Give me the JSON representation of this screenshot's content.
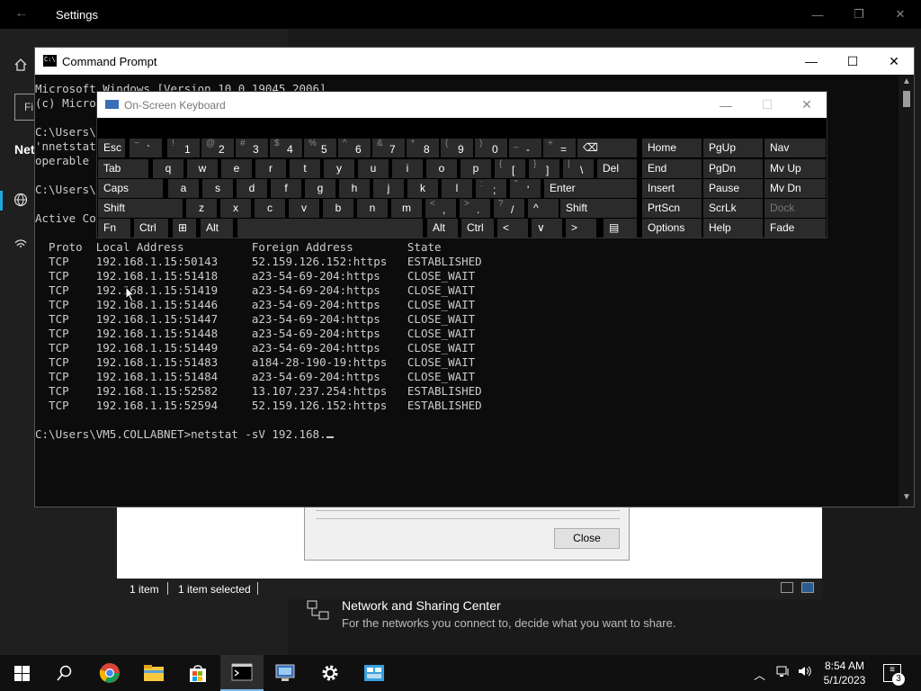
{
  "settings": {
    "title": "Settings",
    "search_placeholder": "Fi",
    "nav_label": "Net",
    "minimize": "—",
    "maximize": "❐",
    "close": "✕"
  },
  "control_panel": {
    "close_label": "Close",
    "status_item_count": "1 item",
    "status_selected": "1 item selected",
    "nsc_title": "Network and Sharing Center",
    "nsc_desc": "For the networks you connect to, decide what you want to share."
  },
  "cmd": {
    "title": "Command Prompt",
    "lines": [
      "Microsoft Windows [Version 10.0.19045.2006]",
      "(c) Micro",
      "",
      "C:\\Users\\",
      "'nnetstat",
      "operable",
      "",
      "C:\\Users\\",
      "",
      "Active Co",
      "",
      "  Proto  Local Address          Foreign Address        State",
      "  TCP    192.168.1.15:50143     52.159.126.152:https   ESTABLISHED",
      "  TCP    192.168.1.15:51418     a23-54-69-204:https    CLOSE_WAIT",
      "  TCP    192.168.1.15:51419     a23-54-69-204:https    CLOSE_WAIT",
      "  TCP    192.168.1.15:51446     a23-54-69-204:https    CLOSE_WAIT",
      "  TCP    192.168.1.15:51447     a23-54-69-204:https    CLOSE_WAIT",
      "  TCP    192.168.1.15:51448     a23-54-69-204:https    CLOSE_WAIT",
      "  TCP    192.168.1.15:51449     a23-54-69-204:https    CLOSE_WAIT",
      "  TCP    192.168.1.15:51483     a184-28-190-19:https   CLOSE_WAIT",
      "  TCP    192.168.1.15:51484     a23-54-69-204:https    CLOSE_WAIT",
      "  TCP    192.168.1.15:52582     13.107.237.254:https   ESTABLISHED",
      "  TCP    192.168.1.15:52594     52.159.126.152:https   ESTABLISHED",
      "",
      "C:\\Users\\VM5.COLLABNET>netstat -sV 192.168."
    ]
  },
  "osk": {
    "title": "On-Screen Keyboard",
    "row1": [
      {
        "t": "Esc"
      },
      {
        "s": "~",
        "b": "`"
      },
      {
        "s": "!",
        "b": "1"
      },
      {
        "s": "@",
        "b": "2"
      },
      {
        "s": "#",
        "b": "3"
      },
      {
        "s": "$",
        "b": "4"
      },
      {
        "s": "%",
        "b": "5"
      },
      {
        "s": "^",
        "b": "6"
      },
      {
        "s": "&",
        "b": "7"
      },
      {
        "s": "*",
        "b": "8"
      },
      {
        "s": "(",
        "b": "9"
      },
      {
        "s": ")",
        "b": "0"
      },
      {
        "s": "_",
        "b": "-"
      },
      {
        "s": "+",
        "b": "="
      },
      {
        "t": "⌫"
      }
    ],
    "row2": [
      {
        "t": "Tab"
      },
      {
        "t": "q"
      },
      {
        "t": "w"
      },
      {
        "t": "e"
      },
      {
        "t": "r"
      },
      {
        "t": "t"
      },
      {
        "t": "y"
      },
      {
        "t": "u"
      },
      {
        "t": "i"
      },
      {
        "t": "o"
      },
      {
        "t": "p"
      },
      {
        "s": "{",
        "b": "["
      },
      {
        "s": "}",
        "b": "]"
      },
      {
        "s": "|",
        "b": "\\"
      },
      {
        "t": "Del"
      }
    ],
    "row3": [
      {
        "t": "Caps"
      },
      {
        "t": "a"
      },
      {
        "t": "s"
      },
      {
        "t": "d"
      },
      {
        "t": "f"
      },
      {
        "t": "g"
      },
      {
        "t": "h"
      },
      {
        "t": "j"
      },
      {
        "t": "k"
      },
      {
        "t": "l"
      },
      {
        "s": ":",
        "b": ";"
      },
      {
        "s": "\"",
        "b": "'"
      },
      {
        "t": "Enter"
      }
    ],
    "row4": [
      {
        "t": "Shift"
      },
      {
        "t": "z"
      },
      {
        "t": "x"
      },
      {
        "t": "c"
      },
      {
        "t": "v"
      },
      {
        "t": "b"
      },
      {
        "t": "n"
      },
      {
        "t": "m"
      },
      {
        "s": "<",
        "b": ","
      },
      {
        "s": ">",
        "b": "."
      },
      {
        "s": "?",
        "b": "/"
      },
      {
        "t": "^"
      },
      {
        "t": "Shift"
      }
    ],
    "row5": [
      {
        "t": "Fn"
      },
      {
        "t": "Ctrl"
      },
      {
        "t": "⊞"
      },
      {
        "t": "Alt"
      },
      {
        "t": ""
      },
      {
        "t": "Alt"
      },
      {
        "t": "Ctrl"
      },
      {
        "t": "<"
      },
      {
        "t": "∨"
      },
      {
        "t": ">"
      },
      {
        "t": "▤"
      }
    ],
    "nav_col1": [
      "Home",
      "End",
      "Insert",
      "PrtScn",
      "Options"
    ],
    "nav_col2": [
      "PgUp",
      "PgDn",
      "Pause",
      "ScrLk",
      "Help"
    ],
    "nav_col3": [
      "Nav",
      "Mv Up",
      "Mv Dn",
      "Dock",
      "Fade"
    ]
  },
  "taskbar": {
    "time": "8:54 AM",
    "date": "5/1/2023",
    "notification_count": "3",
    "apps": [
      "start-icon",
      "search-icon",
      "chrome-icon",
      "file-explorer-icon",
      "store-icon",
      "command-prompt-icon",
      "network-app-icon",
      "settings-icon",
      "control-panel-icon"
    ]
  },
  "colors": {
    "accent": "#1fa7e1",
    "console_bg": "#0c0c0c",
    "console_text": "#cccccc",
    "osk_key": "#2b2b2b",
    "taskbar": "#101010"
  }
}
